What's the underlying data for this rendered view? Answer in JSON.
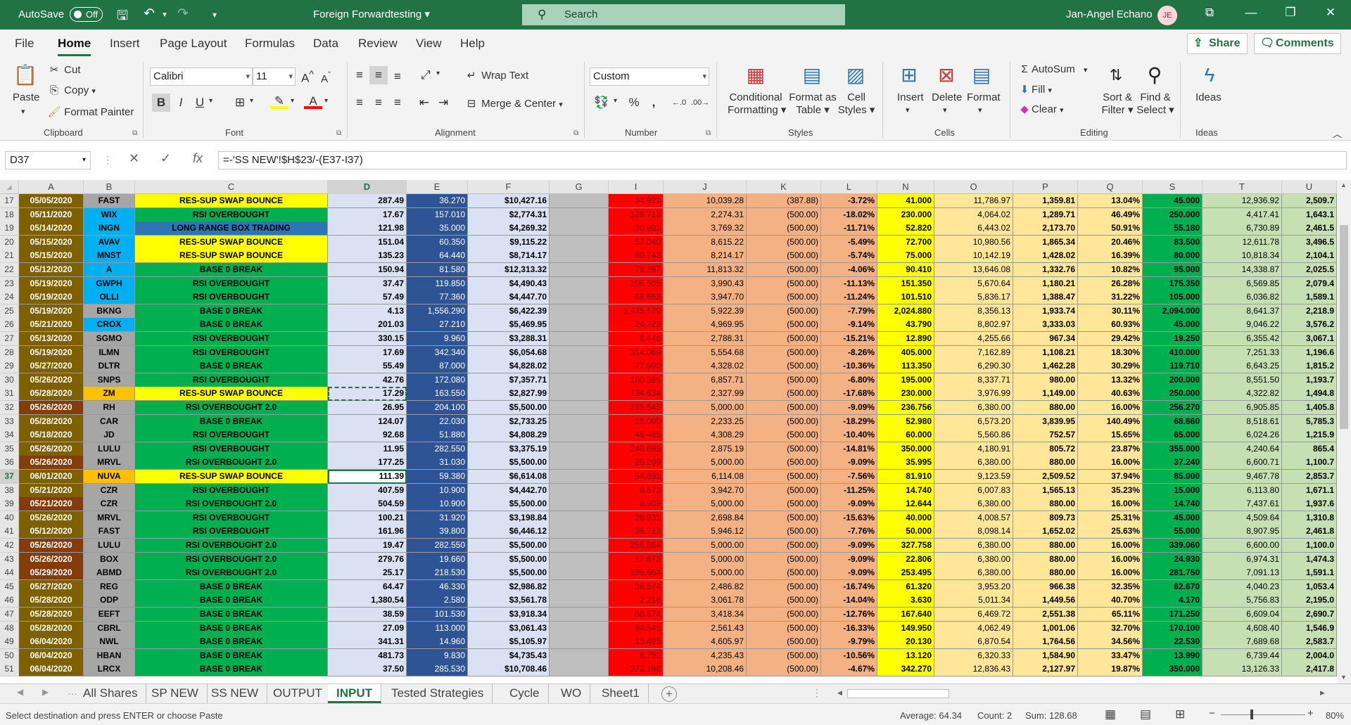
{
  "titlebar": {
    "autosave_label": "AutoSave",
    "autosave_state": "Off",
    "doc_title": "Foreign Forwardtesting",
    "search_placeholder": "Search",
    "user_name": "Jan-Angel Echano",
    "user_initials": "JE"
  },
  "menu": {
    "tabs": [
      "File",
      "Home",
      "Insert",
      "Page Layout",
      "Formulas",
      "Data",
      "Review",
      "View",
      "Help"
    ],
    "active": "Home",
    "share": "Share",
    "comments": "Comments"
  },
  "ribbon": {
    "clipboard": {
      "paste": "Paste",
      "cut": "Cut",
      "copy": "Copy",
      "format_painter": "Format Painter",
      "label": "Clipboard"
    },
    "font": {
      "name": "Calibri",
      "size": "11",
      "label": "Font",
      "colors": {
        "highlight": "#ffff00",
        "font": "#ff0000"
      }
    },
    "alignment": {
      "wrap": "Wrap Text",
      "merge": "Merge & Center",
      "label": "Alignment"
    },
    "number": {
      "format": "Custom",
      "label": "Number"
    },
    "styles": {
      "conditional1": "Conditional",
      "conditional2": "Formatting",
      "format_table1": "Format as",
      "format_table2": "Table",
      "cell_styles1": "Cell",
      "cell_styles2": "Styles",
      "label": "Styles"
    },
    "cells": {
      "insert": "Insert",
      "delete": "Delete",
      "format": "Format",
      "label": "Cells"
    },
    "editing": {
      "autosum": "AutoSum",
      "fill": "Fill",
      "clear": "Clear",
      "sort1": "Sort &",
      "sort2": "Filter",
      "find1": "Find &",
      "find2": "Select",
      "label": "Editing"
    },
    "ideas": {
      "ideas": "Ideas",
      "label": "Ideas"
    }
  },
  "formula_bar": {
    "cell_ref": "D37",
    "formula": "=-'SS NEW'!$H$23/-(E37-I37)"
  },
  "columns": [
    "A",
    "B",
    "C",
    "D",
    "E",
    "F",
    "G",
    "I",
    "J",
    "K",
    "L",
    "N",
    "O",
    "P",
    "Q",
    "S",
    "T",
    "U"
  ],
  "selected_column": "D",
  "rows": [
    {
      "n": "17",
      "a": "05/05/2020",
      "b": "FAST",
      "c": "RES-SUP SWAP BOUNCE",
      "d": "287.49",
      "e": "36.270",
      "f": "$10,427.16",
      "i": "34.921",
      "j": "10,039.28",
      "k": "(387.88)",
      "l": "-3.72%",
      "n2": "41.000",
      "o": "11,786.97",
      "p": "1,359.81",
      "q": "13.04%",
      "s": "45.000",
      "t": "12,936.92",
      "u": "2,509.7"
    },
    {
      "n": "18",
      "a": "05/11/2020",
      "b": "WIX",
      "c": "RSI OVERBOUGHT",
      "d": "17.67",
      "e": "157.010",
      "f": "$2,774.31",
      "i": "128.713",
      "j": "2,274.31",
      "k": "(500.00)",
      "l": "-18.02%",
      "n2": "230.000",
      "o": "4,064.02",
      "p": "1,289.71",
      "q": "46.49%",
      "s": "250.000",
      "t": "4,417.41",
      "u": "1,643.1"
    },
    {
      "n": "19",
      "a": "05/14/2020",
      "b": "INGN",
      "c": "LONG RANGE BOX TRADING",
      "d": "121.98",
      "e": "35.000",
      "f": "$4,269.32",
      "i": "30.901",
      "j": "3,769.32",
      "k": "(500.00)",
      "l": "-11.71%",
      "n2": "52.820",
      "o": "6,443.02",
      "p": "2,173.70",
      "q": "50.91%",
      "s": "55.180",
      "t": "6,730.89",
      "u": "2,461.5"
    },
    {
      "n": "20",
      "a": "05/15/2020",
      "b": "AVAV",
      "c": "RES-SUP SWAP BOUNCE",
      "d": "151.04",
      "e": "60.350",
      "f": "$9,115.22",
      "i": "57.040",
      "j": "8,615.22",
      "k": "(500.00)",
      "l": "-5.49%",
      "n2": "72.700",
      "o": "10,980.56",
      "p": "1,865.34",
      "q": "20.46%",
      "s": "83.500",
      "t": "12,611.78",
      "u": "3,496.5"
    },
    {
      "n": "21",
      "a": "05/15/2020",
      "b": "MNST",
      "c": "RES-SUP SWAP BOUNCE",
      "d": "135.23",
      "e": "64.440",
      "f": "$8,714.17",
      "i": "60.743",
      "j": "8,214.17",
      "k": "(500.00)",
      "l": "-5.74%",
      "n2": "75.000",
      "o": "10,142.19",
      "p": "1,428.02",
      "q": "16.39%",
      "s": "80.000",
      "t": "10,818.34",
      "u": "2,104.1"
    },
    {
      "n": "22",
      "a": "05/12/2020",
      "b": "A",
      "c": "BASE 0 BREAK",
      "d": "150.94",
      "e": "81.580",
      "f": "$12,313.32",
      "i": "78.267",
      "j": "11,813.32",
      "k": "(500.00)",
      "l": "-4.06%",
      "n2": "90.410",
      "o": "13,646.08",
      "p": "1,332.76",
      "q": "10.82%",
      "s": "95.000",
      "t": "14,338.87",
      "u": "2,025.5"
    },
    {
      "n": "23",
      "a": "05/19/2020",
      "b": "GWPH",
      "c": "RSI OVERBOUGHT",
      "d": "37.47",
      "e": "119.850",
      "f": "$4,490.43",
      "i": "106.505",
      "j": "3,990.43",
      "k": "(500.00)",
      "l": "-11.13%",
      "n2": "151.350",
      "o": "5,670.64",
      "p": "1,180.21",
      "q": "26.28%",
      "s": "175.350",
      "t": "6,569.85",
      "u": "2,079.4"
    },
    {
      "n": "24",
      "a": "05/19/2020",
      "b": "OLLI",
      "c": "RSI OVERBOUGHT",
      "d": "57.49",
      "e": "77.360",
      "f": "$4,447.70",
      "i": "68.663",
      "j": "3,947.70",
      "k": "(500.00)",
      "l": "-11.24%",
      "n2": "101.510",
      "o": "5,836.17",
      "p": "1,388.47",
      "q": "31.22%",
      "s": "105.000",
      "t": "6,036.82",
      "u": "1,589.1"
    },
    {
      "n": "25",
      "a": "05/19/2020",
      "b": "BKNG",
      "c": "BASE 0 BREAK",
      "d": "4.13",
      "e": "1,556.290",
      "f": "$6,422.39",
      "i": "1,435.129",
      "j": "5,922.39",
      "k": "(500.00)",
      "l": "-7.79%",
      "n2": "2,024.880",
      "o": "8,356.13",
      "p": "1,933.74",
      "q": "30.11%",
      "s": "2,094.000",
      "t": "8,641.37",
      "u": "2,218.9"
    },
    {
      "n": "26",
      "a": "05/21/2020",
      "b": "CROX",
      "c": "BASE 0 BREAK",
      "d": "201.03",
      "e": "27.210",
      "f": "$5,469.95",
      "i": "24.723",
      "j": "4,969.95",
      "k": "(500.00)",
      "l": "-9.14%",
      "n2": "43.790",
      "o": "8,802.97",
      "p": "3,333.03",
      "q": "60.93%",
      "s": "45.000",
      "t": "9,046.22",
      "u": "3,576.2"
    },
    {
      "n": "27",
      "a": "05/13/2020",
      "b": "SGMO",
      "c": "RSI OVERBOUGHT",
      "d": "330.15",
      "e": "9.960",
      "f": "$3,288.31",
      "i": "8.446",
      "j": "2,788.31",
      "k": "(500.00)",
      "l": "-15.21%",
      "n2": "12.890",
      "o": "4,255.66",
      "p": "967.34",
      "q": "29.42%",
      "s": "19.250",
      "t": "6,355.42",
      "u": "3,067.1"
    },
    {
      "n": "28",
      "a": "05/19/2020",
      "b": "ILMN",
      "c": "RSI OVERBOUGHT",
      "d": "17.69",
      "e": "342.340",
      "f": "$6,054.68",
      "i": "314.069",
      "j": "5,554.68",
      "k": "(500.00)",
      "l": "-8.26%",
      "n2": "405.000",
      "o": "7,162.89",
      "p": "1,108.21",
      "q": "18.30%",
      "s": "410.000",
      "t": "7,251.33",
      "u": "1,196.6"
    },
    {
      "n": "29",
      "a": "05/27/2020",
      "b": "DLTR",
      "c": "BASE 0 BREAK",
      "d": "55.49",
      "e": "87.000",
      "f": "$4,828.02",
      "i": "77.990",
      "j": "4,328.02",
      "k": "(500.00)",
      "l": "-10.36%",
      "n2": "113.350",
      "o": "6,290.30",
      "p": "1,462.28",
      "q": "30.29%",
      "s": "119.710",
      "t": "6,643.25",
      "u": "1,815.2"
    },
    {
      "n": "30",
      "a": "05/26/2020",
      "b": "SNPS",
      "c": "RSI OVERBOUGHT",
      "d": "42.76",
      "e": "172.080",
      "f": "$7,357.71",
      "i": "160.386",
      "j": "6,857.71",
      "k": "(500.00)",
      "l": "-6.80%",
      "n2": "195.000",
      "o": "8,337.71",
      "p": "980.00",
      "q": "13.32%",
      "s": "200.000",
      "t": "8,551.50",
      "u": "1,193.7"
    },
    {
      "n": "31",
      "a": "05/28/2020",
      "b": "ZM",
      "c": "RES-SUP SWAP BOUNCE",
      "d": "17.29",
      "e": "163.550",
      "f": "$2,827.99",
      "i": "134.634",
      "j": "2,327.99",
      "k": "(500.00)",
      "l": "-17.68%",
      "n2": "230.000",
      "o": "3,976.99",
      "p": "1,149.00",
      "q": "40.63%",
      "s": "250.000",
      "t": "4,322.82",
      "u": "1,494.8"
    },
    {
      "n": "32",
      "a": "05/26/2020",
      "b": "RH",
      "c": "RSI OVERBOUGHT 2.0",
      "d": "26.95",
      "e": "204.100",
      "f": "$5,500.00",
      "i": "185.545",
      "j": "5,000.00",
      "k": "(500.00)",
      "l": "-9.09%",
      "n2": "236.756",
      "o": "6,380.00",
      "p": "880.00",
      "q": "16.00%",
      "s": "256.270",
      "t": "6,905.85",
      "u": "1,405.8"
    },
    {
      "n": "33",
      "a": "05/28/2020",
      "b": "CAR",
      "c": "BASE 0 BREAK",
      "d": "124.07",
      "e": "22.030",
      "f": "$2,733.25",
      "i": "18.000",
      "j": "2,233.25",
      "k": "(500.00)",
      "l": "-18.29%",
      "n2": "52.980",
      "o": "6,573.20",
      "p": "3,839.95",
      "q": "140.49%",
      "s": "68.660",
      "t": "8,518.61",
      "u": "5,785.3"
    },
    {
      "n": "34",
      "a": "05/18/2020",
      "b": "JD",
      "c": "RSI OVERBOUGHT",
      "d": "92.68",
      "e": "51.880",
      "f": "$4,808.29",
      "i": "46.485",
      "j": "4,308.29",
      "k": "(500.00)",
      "l": "-10.40%",
      "n2": "60.000",
      "o": "5,560.86",
      "p": "752.57",
      "q": "15.65%",
      "s": "65.000",
      "t": "6,024.26",
      "u": "1,215.9"
    },
    {
      "n": "35",
      "a": "05/26/2020",
      "b": "LULU",
      "c": "RSI OVERBOUGHT",
      "d": "11.95",
      "e": "282.550",
      "f": "$3,375.19",
      "i": "240.693",
      "j": "2,875.19",
      "k": "(500.00)",
      "l": "-14.81%",
      "n2": "350.000",
      "o": "4,180.91",
      "p": "805.72",
      "q": "23.87%",
      "s": "355.000",
      "t": "4,240.64",
      "u": "865.4"
    },
    {
      "n": "36",
      "a": "05/26/2020",
      "b": "MRVL",
      "c": "RSI OVERBOUGHT 2.0",
      "d": "177.25",
      "e": "31.030",
      "f": "$5,500.00",
      "i": "28.209",
      "j": "5,000.00",
      "k": "(500.00)",
      "l": "-9.09%",
      "n2": "35.995",
      "o": "6,380.00",
      "p": "880.00",
      "q": "16.00%",
      "s": "37.240",
      "t": "6,600.71",
      "u": "1,100.7"
    },
    {
      "n": "37",
      "a": "06/01/2020",
      "b": "NUVA",
      "c": "RES-SUP SWAP BOUNCE",
      "d": "111.39",
      "e": "59.380",
      "f": "$6,614.08",
      "i": "54.891",
      "j": "6,114.08",
      "k": "(500.00)",
      "l": "-7.56%",
      "n2": "81.910",
      "o": "9,123.59",
      "p": "2,509.52",
      "q": "37.94%",
      "s": "85.000",
      "t": "9,467.78",
      "u": "2,853.7"
    },
    {
      "n": "38",
      "a": "05/21/2020",
      "b": "CZR",
      "c": "RSI OVERBOUGHT",
      "d": "407.59",
      "e": "10.900",
      "f": "$4,442.70",
      "i": "9.673",
      "j": "3,942.70",
      "k": "(500.00)",
      "l": "-11.25%",
      "n2": "14.740",
      "o": "6,007.83",
      "p": "1,565.13",
      "q": "35.23%",
      "s": "15.000",
      "t": "6,113.80",
      "u": "1,671.1"
    },
    {
      "n": "39",
      "a": "05/21/2020",
      "b": "CZR",
      "c": "RSI OVERBOUGHT 2.0",
      "d": "504.59",
      "e": "10.900",
      "f": "$5,500.00",
      "i": "9.909",
      "j": "5,000.00",
      "k": "(500.00)",
      "l": "-9.09%",
      "n2": "12.644",
      "o": "6,380.00",
      "p": "880.00",
      "q": "16.00%",
      "s": "14.740",
      "t": "7,437.61",
      "u": "1,937.6"
    },
    {
      "n": "40",
      "a": "05/26/2020",
      "b": "MRVL",
      "c": "RSI OVERBOUGHT",
      "d": "100.21",
      "e": "31.920",
      "f": "$3,198.84",
      "i": "26.931",
      "j": "2,698.84",
      "k": "(500.00)",
      "l": "-15.63%",
      "n2": "40.000",
      "o": "4,008.57",
      "p": "809.73",
      "q": "25.31%",
      "s": "45.000",
      "t": "4,509.64",
      "u": "1,310.8"
    },
    {
      "n": "41",
      "a": "05/12/2020",
      "b": "FAST",
      "c": "RSI OVERBOUGHT",
      "d": "161.96",
      "e": "39.800",
      "f": "$6,446.12",
      "i": "36.713",
      "j": "5,946.12",
      "k": "(500.00)",
      "l": "-7.76%",
      "n2": "50.000",
      "o": "8,098.14",
      "p": "1,652.02",
      "q": "25.63%",
      "s": "55.000",
      "t": "8,907.95",
      "u": "2,461.8"
    },
    {
      "n": "42",
      "a": "05/26/2020",
      "b": "LULU",
      "c": "RSI OVERBOUGHT 2.0",
      "d": "19.47",
      "e": "282.550",
      "f": "$5,500.00",
      "i": "256.864",
      "j": "5,000.00",
      "k": "(500.00)",
      "l": "-9.09%",
      "n2": "327.758",
      "o": "6,380.00",
      "p": "880.00",
      "q": "16.00%",
      "s": "339.060",
      "t": "6,600.00",
      "u": "1,100.0"
    },
    {
      "n": "43",
      "a": "05/26/2020",
      "b": "BOX",
      "c": "RSI OVERBOUGHT 2.0",
      "d": "279.76",
      "e": "19.660",
      "f": "$5,500.00",
      "i": "17.873",
      "j": "5,000.00",
      "k": "(500.00)",
      "l": "-9.09%",
      "n2": "22.806",
      "o": "6,380.00",
      "p": "880.00",
      "q": "16.00%",
      "s": "24.930",
      "t": "6,974.31",
      "u": "1,474.3"
    },
    {
      "n": "44",
      "a": "05/29/2020",
      "b": "ABMD",
      "c": "RSI OVERBOUGHT 2.0",
      "d": "25.17",
      "e": "218.530",
      "f": "$5,500.00",
      "i": "198.664",
      "j": "5,000.00",
      "k": "(500.00)",
      "l": "-9.09%",
      "n2": "253.495",
      "o": "6,380.00",
      "p": "880.00",
      "q": "16.00%",
      "s": "281.750",
      "t": "7,091.13",
      "u": "1,591.1"
    },
    {
      "n": "45",
      "a": "05/27/2020",
      "b": "REG",
      "c": "BASE 0 BREAK",
      "d": "64.47",
      "e": "46.330",
      "f": "$2,986.82",
      "i": "38.574",
      "j": "2,486.82",
      "k": "(500.00)",
      "l": "-16.74%",
      "n2": "61.320",
      "o": "3,953.20",
      "p": "966.38",
      "q": "32.35%",
      "s": "62.670",
      "t": "4,040.23",
      "u": "1,053.4"
    },
    {
      "n": "46",
      "a": "05/28/2020",
      "b": "ODP",
      "c": "BASE 0 BREAK",
      "d": "1,380.54",
      "e": "2.580",
      "f": "$3,561.78",
      "i": "2.218",
      "j": "3,061.78",
      "k": "(500.00)",
      "l": "-14.04%",
      "n2": "3.630",
      "o": "5,011.34",
      "p": "1,449.56",
      "q": "40.70%",
      "s": "4.170",
      "t": "5,756.83",
      "u": "2,195.0"
    },
    {
      "n": "47",
      "a": "05/28/2020",
      "b": "EEFT",
      "c": "BASE 0 BREAK",
      "d": "38.59",
      "e": "101.530",
      "f": "$3,918.34",
      "i": "88.574",
      "j": "3,418.34",
      "k": "(500.00)",
      "l": "-12.76%",
      "n2": "167.640",
      "o": "6,469.72",
      "p": "2,551.38",
      "q": "65.11%",
      "s": "171.250",
      "t": "6,609.04",
      "u": "2,690.7"
    },
    {
      "n": "48",
      "a": "05/28/2020",
      "b": "CBRL",
      "c": "BASE 0 BREAK",
      "d": "27.09",
      "e": "113.000",
      "f": "$3,061.43",
      "i": "94.545",
      "j": "2,561.43",
      "k": "(500.00)",
      "l": "-16.33%",
      "n2": "149.950",
      "o": "4,062.49",
      "p": "1,001.06",
      "q": "32.70%",
      "s": "170.100",
      "t": "4,608.40",
      "u": "1,546.9"
    },
    {
      "n": "49",
      "a": "06/04/2020",
      "b": "NWL",
      "c": "BASE 0 BREAK",
      "d": "341.31",
      "e": "14.960",
      "f": "$5,105.97",
      "i": "13.495",
      "j": "4,605.97",
      "k": "(500.00)",
      "l": "-9.79%",
      "n2": "20.130",
      "o": "6,870.54",
      "p": "1,764.56",
      "q": "34.56%",
      "s": "22.530",
      "t": "7,689.68",
      "u": "2,583.7"
    },
    {
      "n": "50",
      "a": "06/04/2020",
      "b": "HBAN",
      "c": "BASE 0 BREAK",
      "d": "481.73",
      "e": "9.830",
      "f": "$4,735.43",
      "i": "8.792",
      "j": "4,235.43",
      "k": "(500.00)",
      "l": "-10.56%",
      "n2": "13.120",
      "o": "6,320.33",
      "p": "1,584.90",
      "q": "33.47%",
      "s": "13.990",
      "t": "6,739.44",
      "u": "2,004.0"
    },
    {
      "n": "51",
      "a": "06/04/2020",
      "b": "LRCX",
      "c": "BASE 0 BREAK",
      "d": "37.50",
      "e": "285.530",
      "f": "$10,708.46",
      "i": "272.198",
      "j": "10,208.46",
      "k": "(500.00)",
      "l": "-4.67%",
      "n2": "342.270",
      "o": "12,836.43",
      "p": "2,127.97",
      "q": "19.87%",
      "s": "350.000",
      "t": "13,126.33",
      "u": "2,417.8"
    }
  ],
  "strategy_colors": {
    "RES-SUP SWAP BOUNCE": "#ffff00",
    "RSI OVERBOUGHT": "#00b050",
    "RSI OVERBOUGHT 2.0": "#00b050",
    "BASE 0 BREAK": "#00b050",
    "LONG RANGE BOX TRADING": "#2e75b6"
  },
  "sheet_tabs": [
    "All Shares",
    "SP NEW",
    "SS NEW",
    "OUTPUT",
    "INPUT",
    "Tested Strategies",
    "Cycle",
    "WO",
    "Sheet1"
  ],
  "active_sheet": "INPUT",
  "status": {
    "message": "Select destination and press ENTER or choose Paste",
    "average": "Average: 64.34",
    "count": "Count: 2",
    "sum": "Sum: 128.68",
    "zoom": "80%"
  }
}
